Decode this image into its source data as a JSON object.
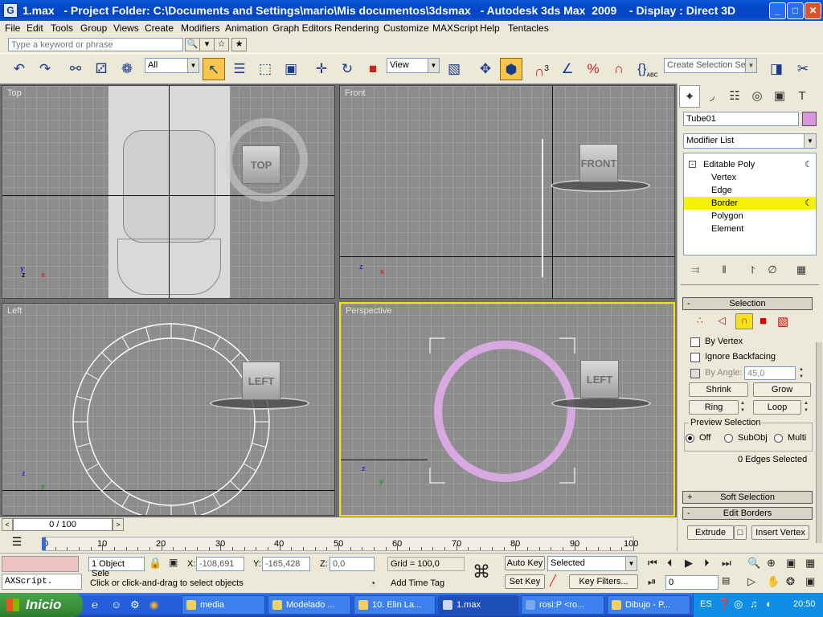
{
  "window": {
    "file": "1.max",
    "title_rest": "   - Project Folder: C:\\Documents and Settings\\mario\\Mis documentos\\3dsmax   - Autodesk 3ds Max  2009    - Display : Direct 3D",
    "buttons": [
      "_",
      "□",
      "✕"
    ]
  },
  "menu": [
    "File",
    "Edit",
    "Tools",
    "Group",
    "Views",
    "Create",
    "Modifiers",
    "Animation",
    "Graph Editors",
    "Rendering",
    "Customize",
    "MAXScript",
    "Help",
    "Tentacles"
  ],
  "search": {
    "placeholder": "Type a keyword or phrase"
  },
  "toolbar": {
    "filter": "All",
    "ref_coord": "View",
    "selection_set": "Create Selection Set",
    "snap_label": "3",
    "abc_label": "ABC"
  },
  "viewports": {
    "top": {
      "label": "Top",
      "cube": "TOP"
    },
    "front": {
      "label": "Front",
      "cube": "FRONT"
    },
    "left": {
      "label": "Left",
      "cube": "LEFT"
    },
    "perspective": {
      "label": "Perspective",
      "cube": "LEFT"
    },
    "axis": {
      "x": "x",
      "y": "y",
      "z": "z"
    }
  },
  "command_panel": {
    "object_name": "Tube01",
    "object_color": "#d896de",
    "modifier_list": "Modifier List",
    "stack": [
      {
        "label": "Editable Poly",
        "level": 0,
        "selected": false
      },
      {
        "label": "Vertex",
        "level": 1,
        "selected": false
      },
      {
        "label": "Edge",
        "level": 1,
        "selected": false
      },
      {
        "label": "Border",
        "level": 1,
        "selected": true
      },
      {
        "label": "Polygon",
        "level": 1,
        "selected": false
      },
      {
        "label": "Element",
        "level": 1,
        "selected": false
      }
    ],
    "selection": {
      "title": "Selection",
      "by_vertex": "By Vertex",
      "ignore_backfacing": "Ignore Backfacing",
      "by_angle": "By Angle:",
      "angle_value": "45,0",
      "shrink": "Shrink",
      "grow": "Grow",
      "ring": "Ring",
      "loop": "Loop",
      "preview_title": "Preview Selection",
      "preview_off": "Off",
      "preview_subobj": "SubObj",
      "preview_multi": "Multi",
      "status": "0 Edges Selected"
    },
    "soft_selection": "Soft Selection",
    "edit_borders": "Edit Borders",
    "extrude": "Extrude",
    "insert_vertex": "Insert Vertex"
  },
  "timeline": {
    "slider": "0 / 100",
    "ticks": [
      "0",
      "10",
      "20",
      "30",
      "40",
      "50",
      "60",
      "70",
      "80",
      "90",
      "100"
    ]
  },
  "status": {
    "maxscript": "AXScript.",
    "selected": "1 Object Sele",
    "x_label": "X:",
    "x": "-108,691",
    "y_label": "Y:",
    "y": "-165,428",
    "z_label": "Z:",
    "z": "0,0",
    "grid": "Grid = 100,0",
    "prompt": "Click or click-and-drag to select objects",
    "add_time_tag": "Add Time Tag",
    "auto_key": "Auto Key",
    "selected_dd": "Selected",
    "set_key": "Set Key",
    "key_filters": "Key Filters...",
    "frame": "0"
  },
  "taskbar": {
    "start": "Inicio",
    "tasks": [
      "media",
      "Modelado ...",
      "10. Elin La...",
      "1.max",
      "rosi:P <ro...",
      "Dibujo - P..."
    ],
    "lang": "ES",
    "time": "20:50"
  }
}
